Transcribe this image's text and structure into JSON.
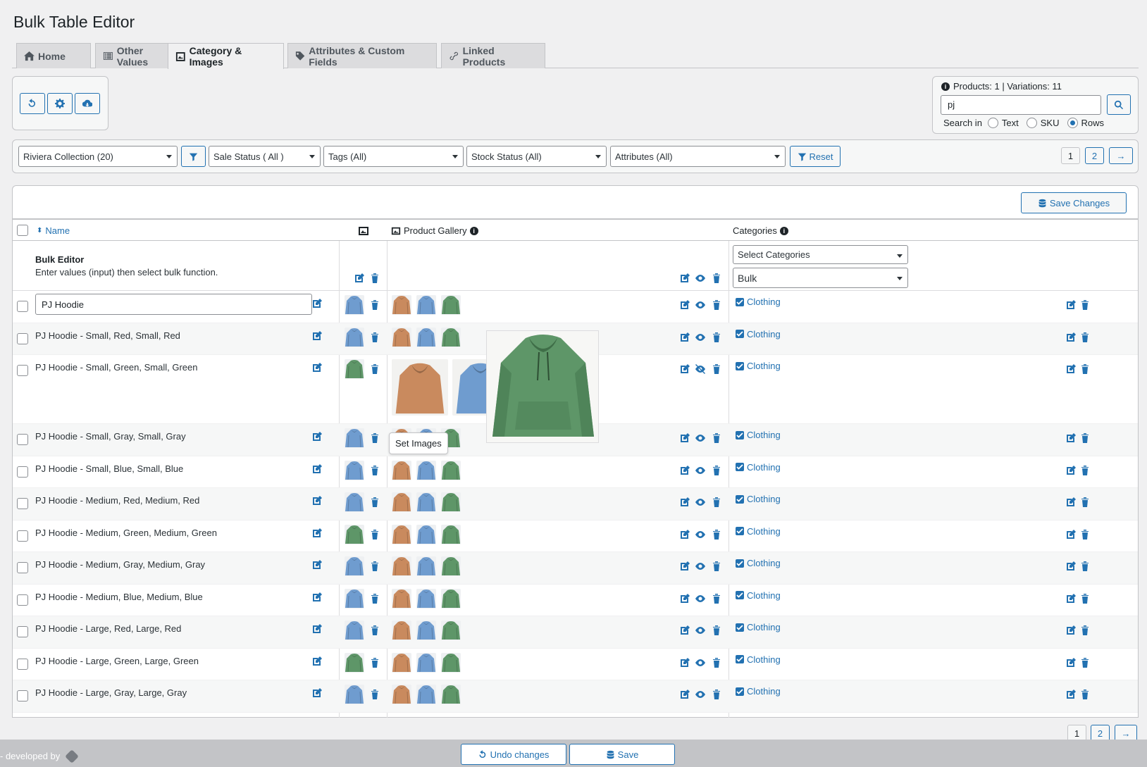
{
  "page_title": "Bulk Table Editor",
  "tabs": [
    {
      "label": "Home",
      "icon": "home-icon",
      "active": false
    },
    {
      "label": "Other Values",
      "icon": "list-icon",
      "active": false
    },
    {
      "label": "Category & Images",
      "icon": "image-icon",
      "active": true
    },
    {
      "label": "Attributes & Custom Fields",
      "icon": "tag-icon",
      "active": false
    },
    {
      "label": "Linked Products",
      "icon": "link-icon",
      "active": false
    }
  ],
  "search": {
    "summary": "Products: 1 | Variations: 11",
    "value": "pj",
    "search_in_label": "Search in",
    "options": [
      "Text",
      "SKU",
      "Rows"
    ],
    "selected": "Rows"
  },
  "filters": {
    "category": "Riviera Collection  (20)",
    "sale_status": "Sale Status ( All )",
    "tags": "Tags (All)",
    "stock_status": "Stock Status (All)",
    "attributes": "Attributes (All)",
    "reset_label": "Reset"
  },
  "pagination": {
    "pages": [
      "1",
      "2"
    ],
    "current": "1",
    "next": "→"
  },
  "save_changes_label": "Save Changes",
  "columns": {
    "name": "Name",
    "gallery": "Product Gallery",
    "categories": "Categories"
  },
  "bulk_editor": {
    "title": "Bulk Editor",
    "hint": "Enter values (input) then select bulk function.",
    "categories_placeholder": "Select Categories",
    "bulk_select": "Bulk"
  },
  "rows": [
    {
      "name": "PJ Hoodie",
      "image": "blue",
      "category": "Clothing"
    },
    {
      "name": "PJ Hoodie - Small, Red, Small, Red",
      "image": "blue",
      "category": "Clothing"
    },
    {
      "name": "PJ Hoodie - Small, Green, Small, Green",
      "image": "green",
      "category": "Clothing"
    },
    {
      "name": "PJ Hoodie - Small, Gray, Small, Gray",
      "image": "blue",
      "category": "Clothing"
    },
    {
      "name": "PJ Hoodie - Small, Blue, Small, Blue",
      "image": "blue",
      "category": "Clothing"
    },
    {
      "name": "PJ Hoodie - Medium, Red, Medium, Red",
      "image": "blue",
      "category": "Clothing"
    },
    {
      "name": "PJ Hoodie - Medium, Green, Medium, Green",
      "image": "green",
      "category": "Clothing"
    },
    {
      "name": "PJ Hoodie - Medium, Gray, Medium, Gray",
      "image": "blue",
      "category": "Clothing"
    },
    {
      "name": "PJ Hoodie - Medium, Blue, Medium, Blue",
      "image": "blue",
      "category": "Clothing"
    },
    {
      "name": "PJ Hoodie - Large, Red, Large, Red",
      "image": "blue",
      "category": "Clothing"
    },
    {
      "name": "PJ Hoodie - Large, Green, Large, Green",
      "image": "green",
      "category": "Clothing"
    },
    {
      "name": "PJ Hoodie - Large, Gray, Large, Gray",
      "image": "blue",
      "category": "Clothing"
    }
  ],
  "tooltip": "Set Images",
  "footer": {
    "developed_by": "- developed by",
    "undo_label": "Undo changes",
    "save_label": "Save"
  },
  "colors": {
    "accent": "#2271b1",
    "hoodie_orange": "#c98a5e",
    "hoodie_blue": "#6f9ccf",
    "hoodie_green": "#5e9668"
  }
}
